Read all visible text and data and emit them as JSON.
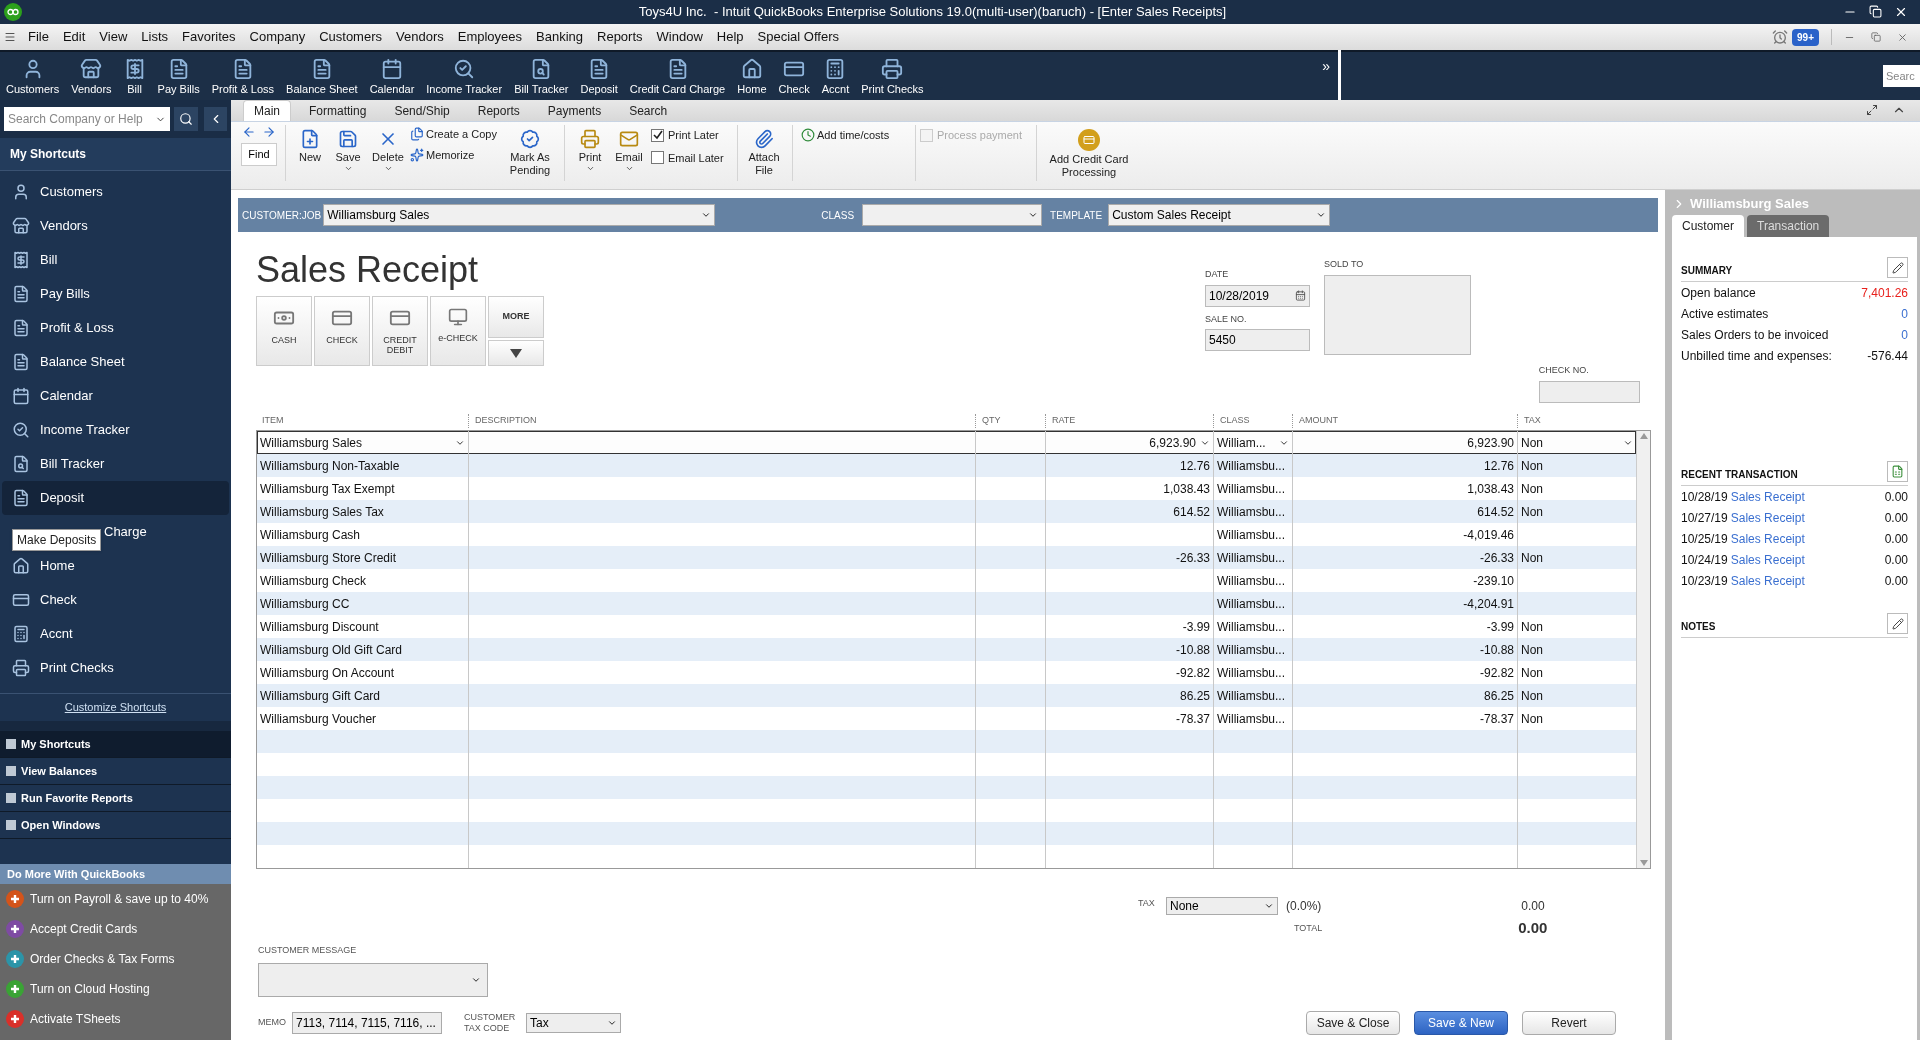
{
  "window": {
    "title": "Toys4U Inc.  - Intuit QuickBooks Enterprise Solutions 19.0(multi-user)(baruch) - [Enter Sales Receipts]"
  },
  "menu": [
    "File",
    "Edit",
    "View",
    "Lists",
    "Favorites",
    "Company",
    "Customers",
    "Vendors",
    "Employees",
    "Banking",
    "Reports",
    "Window",
    "Help",
    "Special Offers"
  ],
  "reminders_badge": "99+",
  "icon_bar": {
    "items": [
      "Customers",
      "Vendors",
      "Bill",
      "Pay Bills",
      "Profit & Loss",
      "Balance Sheet",
      "Calendar",
      "Income Tracker",
      "Bill Tracker",
      "Deposit",
      "Credit Card Charge",
      "Home",
      "Check",
      "Accnt",
      "Print Checks"
    ],
    "more": "»",
    "search": {
      "placeholder": "Searc"
    }
  },
  "sidebar": {
    "search": {
      "placeholder": "Search Company or Help"
    },
    "title": "My Shortcuts",
    "items": [
      {
        "label": "Customers",
        "selected": false
      },
      {
        "label": "Vendors",
        "selected": false
      },
      {
        "label": "Bill",
        "selected": false
      },
      {
        "label": "Pay Bills",
        "selected": false
      },
      {
        "label": "Profit & Loss",
        "selected": false
      },
      {
        "label": "Balance Sheet",
        "selected": false
      },
      {
        "label": "Calendar",
        "selected": false
      },
      {
        "label": "Income Tracker",
        "selected": false
      },
      {
        "label": "Bill Tracker",
        "selected": false
      },
      {
        "label": "Deposit",
        "selected": true
      },
      {
        "label": "Charge",
        "selected": false,
        "tooltip": "Make Deposits"
      },
      {
        "label": "Home",
        "selected": false
      },
      {
        "label": "Check",
        "selected": false
      },
      {
        "label": "Accnt",
        "selected": false
      },
      {
        "label": "Print Checks",
        "selected": false
      }
    ],
    "customize": "Customize Shortcuts",
    "sections": [
      {
        "label": "My Shortcuts",
        "selected": true
      },
      {
        "label": "View Balances",
        "selected": false
      },
      {
        "label": "Run Favorite Reports",
        "selected": false
      },
      {
        "label": "Open Windows",
        "selected": false
      }
    ],
    "promo": {
      "title": "Do More With QuickBooks",
      "items": [
        {
          "label": "Turn on Payroll & save up to 40%",
          "color": "#d4541a"
        },
        {
          "label": "Accept Credit Cards",
          "color": "#7e4ba3"
        },
        {
          "label": "Order Checks & Tax Forms",
          "color": "#2c94a8"
        },
        {
          "label": "Turn on Cloud Hosting",
          "color": "#3aa335"
        },
        {
          "label": "Activate TSheets",
          "color": "#d9302a"
        }
      ]
    }
  },
  "ribbon": {
    "tabs": [
      {
        "label": "Main",
        "selected": true
      },
      {
        "label": "Formatting",
        "selected": false
      },
      {
        "label": "Send/Ship",
        "selected": false
      },
      {
        "label": "Reports",
        "selected": false
      },
      {
        "label": "Payments",
        "selected": false
      },
      {
        "label": "Search",
        "selected": false
      }
    ],
    "find": "Find",
    "new": "New",
    "save": "Save",
    "delete": "Delete",
    "create_copy": "Create a Copy",
    "memorize": "Memorize",
    "mark_pending": "Mark As Pending",
    "print": "Print",
    "email": "Email",
    "print_later": {
      "label": "Print Later",
      "checked": true
    },
    "email_later": {
      "label": "Email Later",
      "checked": false
    },
    "attach": "Attach File",
    "add_time": "Add time/costs",
    "process_payment": {
      "label": "Process payment",
      "checked": false,
      "disabled": true
    },
    "add_cc": "Add Credit Card Processing"
  },
  "form": {
    "customer_job": {
      "label": "CUSTOMER:JOB",
      "value": "Williamsburg Sales"
    },
    "class": {
      "label": "CLASS"
    },
    "template": {
      "label": "TEMPLATE",
      "value": "Custom Sales Receipt"
    },
    "title": "Sales Receipt",
    "payment_methods": [
      "CASH",
      "CHECK",
      "CREDIT DEBIT",
      "e-CHECK"
    ],
    "more": "MORE",
    "date": {
      "label": "DATE",
      "value": "10/28/2019"
    },
    "sale_no": {
      "label": "SALE NO.",
      "value": "5450"
    },
    "sold_to": {
      "label": "SOLD TO"
    },
    "check_no": {
      "label": "CHECK NO."
    }
  },
  "table": {
    "columns": [
      "ITEM",
      "DESCRIPTION",
      "QTY",
      "RATE",
      "CLASS",
      "AMOUNT",
      "TAX"
    ],
    "rows": [
      {
        "item": "Williamsburg Sales",
        "rate": "6,923.90",
        "class": "William...",
        "amount": "6,923.90",
        "tax": "Non",
        "selected": true
      },
      {
        "item": "Williamsburg Non-Taxable",
        "rate": "12.76",
        "class": "Williamsbu...",
        "amount": "12.76",
        "tax": "Non",
        "selected": false
      },
      {
        "item": "Williamsburg  Tax Exempt",
        "rate": "1,038.43",
        "class": "Williamsbu...",
        "amount": "1,038.43",
        "tax": "Non",
        "selected": false
      },
      {
        "item": "Williamsburg Sales Tax",
        "rate": "614.52",
        "class": "Williamsbu...",
        "amount": "614.52",
        "tax": "Non",
        "selected": false
      },
      {
        "item": "Williamsburg Cash",
        "class": "Williamsbu...",
        "amount": "-4,019.46",
        "selected": false
      },
      {
        "item": "Williamsburg  Store Credit",
        "rate": "-26.33",
        "class": "Williamsbu...",
        "amount": "-26.33",
        "tax": "Non",
        "selected": false
      },
      {
        "item": "Williamsburg  Check",
        "class": "Williamsbu...",
        "amount": "-239.10",
        "selected": false
      },
      {
        "item": "Williamsburg  CC",
        "class": "Williamsbu...",
        "amount": "-4,204.91",
        "selected": false
      },
      {
        "item": "Williamsburg Discount",
        "rate": "-3.99",
        "class": "Williamsbu...",
        "amount": "-3.99",
        "tax": "Non",
        "selected": false
      },
      {
        "item": "Williamsburg Old Gift Card",
        "rate": "-10.88",
        "class": "Williamsbu...",
        "amount": "-10.88",
        "tax": "Non",
        "selected": false
      },
      {
        "item": "Williamsburg On Account",
        "rate": "-92.82",
        "class": "Williamsbu...",
        "amount": "-92.82",
        "tax": "Non",
        "selected": false
      },
      {
        "item": "Williamsburg Gift Card",
        "rate": "86.25",
        "class": "Williamsbu...",
        "amount": "86.25",
        "tax": "Non",
        "selected": false
      },
      {
        "item": "Williamsburg Voucher",
        "rate": "-78.37",
        "class": "Williamsbu...",
        "amount": "-78.37",
        "tax": "Non",
        "selected": false
      }
    ]
  },
  "totals": {
    "tax_label": "TAX",
    "tax_value": "None",
    "tax_rate": "(0.0%)",
    "tax_amount": "0.00",
    "total_label": "TOTAL",
    "total": "0.00"
  },
  "footer": {
    "customer_message": {
      "label": "CUSTOMER MESSAGE"
    },
    "memo": {
      "label": "MEMO",
      "value": "7113, 7114, 7115, 7116, ..."
    },
    "tax_code": {
      "label": "CUSTOMER TAX CODE",
      "value": "Tax"
    },
    "buttons": [
      {
        "label": "Save & Close",
        "kind": "default"
      },
      {
        "label": "Save & New",
        "kind": "primary"
      },
      {
        "label": "Revert",
        "kind": "default"
      }
    ]
  },
  "panel": {
    "title": "Williamsburg Sales",
    "tabs": [
      {
        "label": "Customer",
        "selected": true
      },
      {
        "label": "Transaction",
        "selected": false
      }
    ],
    "summary": {
      "title": "SUMMARY",
      "rows": [
        {
          "label": "Open balance",
          "value": "7,401.26",
          "kind": "alert"
        },
        {
          "label": "Active estimates",
          "value": "0",
          "kind": "link"
        },
        {
          "label": "Sales Orders to be invoiced",
          "value": "0",
          "kind": "link"
        },
        {
          "label": "Unbilled time and expenses:",
          "value": "-576.44",
          "kind": "plain"
        }
      ]
    },
    "recent": {
      "title": "RECENT TRANSACTION",
      "rows": [
        {
          "date": "10/28/19",
          "link": "Sales Receipt",
          "amount": "0.00"
        },
        {
          "date": "10/27/19",
          "link": "Sales Receipt",
          "amount": "0.00"
        },
        {
          "date": "10/25/19",
          "link": "Sales Receipt",
          "amount": "0.00"
        },
        {
          "date": "10/24/19",
          "link": "Sales Receipt",
          "amount": "0.00"
        },
        {
          "date": "10/23/19",
          "link": "Sales Receipt",
          "amount": "0.00"
        }
      ]
    },
    "notes": {
      "title": "NOTES"
    }
  }
}
